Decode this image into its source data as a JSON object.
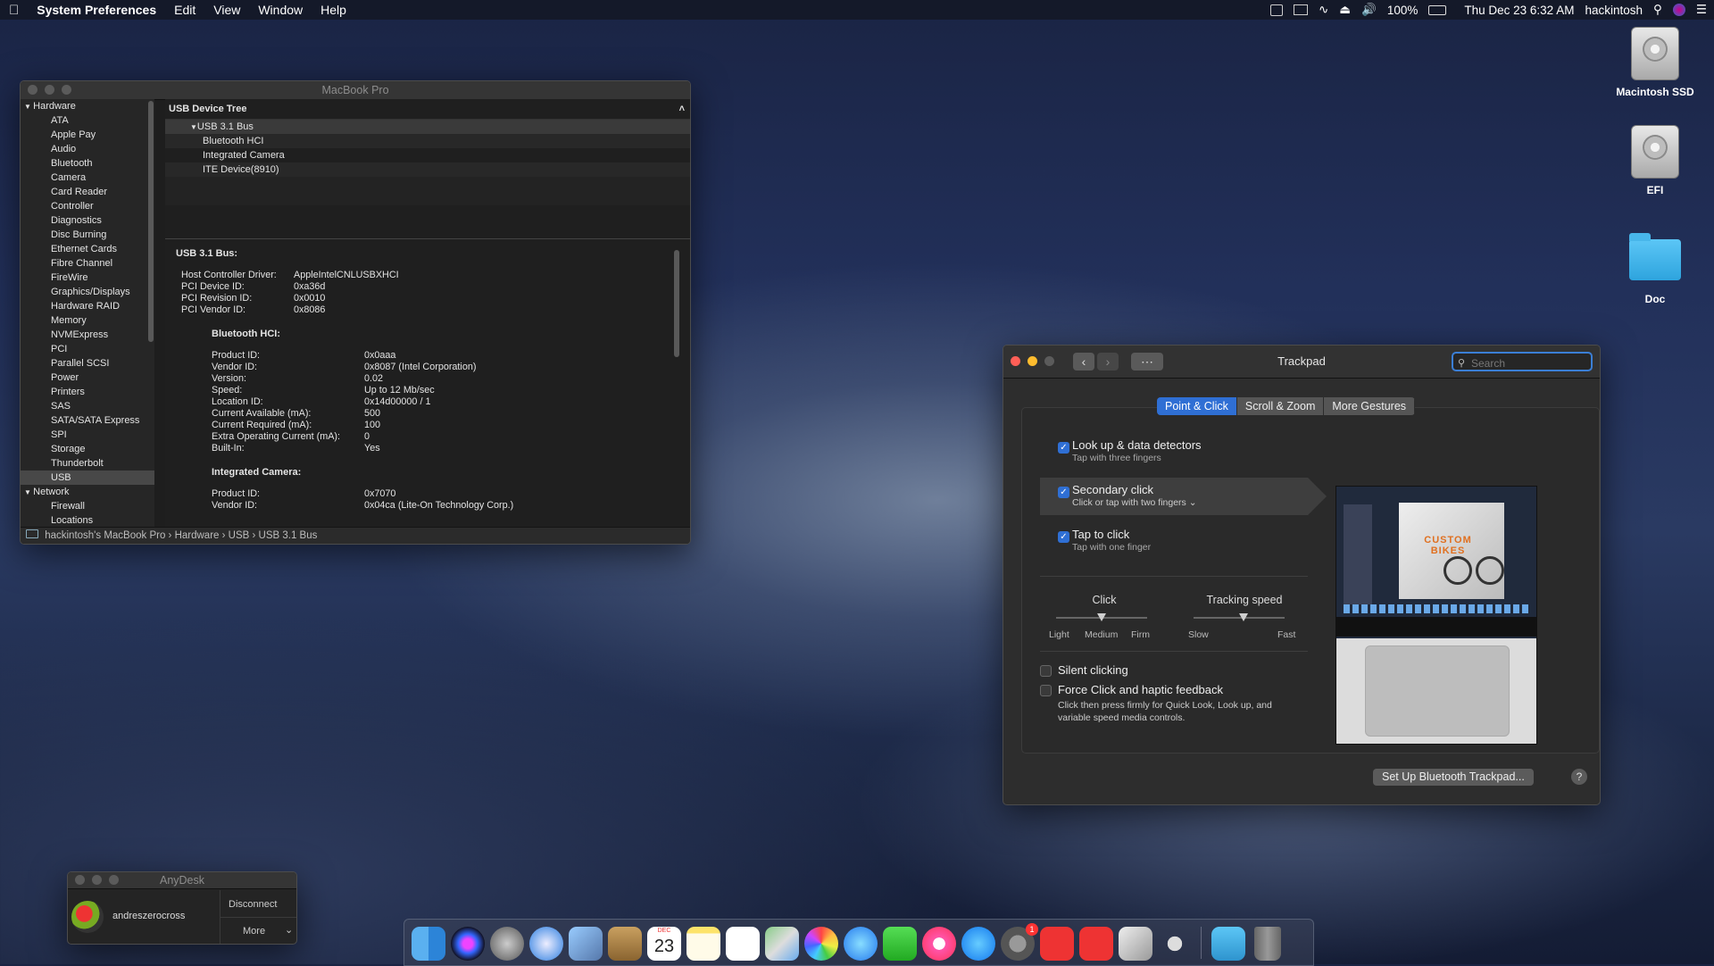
{
  "menubar": {
    "app": "System Preferences",
    "menus": [
      "Edit",
      "View",
      "Window",
      "Help"
    ],
    "battery": "100%",
    "datetime": "Thu Dec 23  6:32 AM",
    "user": "hackintosh"
  },
  "desktop_icons": [
    "Macintosh SSD",
    "EFI",
    "Doc"
  ],
  "sysinfo": {
    "title": "MacBook Pro",
    "sidebar": [
      {
        "label": "Hardware",
        "group": true
      },
      {
        "label": "ATA"
      },
      {
        "label": "Apple Pay"
      },
      {
        "label": "Audio"
      },
      {
        "label": "Bluetooth"
      },
      {
        "label": "Camera"
      },
      {
        "label": "Card Reader"
      },
      {
        "label": "Controller"
      },
      {
        "label": "Diagnostics"
      },
      {
        "label": "Disc Burning"
      },
      {
        "label": "Ethernet Cards"
      },
      {
        "label": "Fibre Channel"
      },
      {
        "label": "FireWire"
      },
      {
        "label": "Graphics/Displays"
      },
      {
        "label": "Hardware RAID"
      },
      {
        "label": "Memory"
      },
      {
        "label": "NVMExpress"
      },
      {
        "label": "PCI"
      },
      {
        "label": "Parallel SCSI"
      },
      {
        "label": "Power"
      },
      {
        "label": "Printers"
      },
      {
        "label": "SAS"
      },
      {
        "label": "SATA/SATA Express"
      },
      {
        "label": "SPI"
      },
      {
        "label": "Storage"
      },
      {
        "label": "Thunderbolt"
      },
      {
        "label": "USB",
        "selected": true
      },
      {
        "label": "Network",
        "group": true
      },
      {
        "label": "Firewall"
      },
      {
        "label": "Locations"
      }
    ],
    "tree_header": "USB Device Tree",
    "tree": [
      {
        "label": "USB 3.1 Bus",
        "bus": true
      },
      {
        "label": "Bluetooth HCI"
      },
      {
        "label": "Integrated Camera"
      },
      {
        "label": "ITE Device(8910)"
      }
    ],
    "detail_title": "USB 3.1 Bus:",
    "bus_props": [
      [
        "Host Controller Driver:",
        "AppleIntelCNLUSBXHCI"
      ],
      [
        "PCI Device ID:",
        "0xa36d"
      ],
      [
        "PCI Revision ID:",
        "0x0010"
      ],
      [
        "PCI Vendor ID:",
        "0x8086"
      ]
    ],
    "bt_title": "Bluetooth HCI:",
    "bt_props": [
      [
        "Product ID:",
        "0x0aaa"
      ],
      [
        "Vendor ID:",
        "0x8087  (Intel Corporation)"
      ],
      [
        "Version:",
        "0.02"
      ],
      [
        "Speed:",
        "Up to 12 Mb/sec"
      ],
      [
        "Location ID:",
        "0x14d00000 / 1"
      ],
      [
        "Current Available (mA):",
        "500"
      ],
      [
        "Current Required (mA):",
        "100"
      ],
      [
        "Extra Operating Current (mA):",
        "0"
      ],
      [
        "Built-In:",
        "Yes"
      ]
    ],
    "cam_title": "Integrated Camera:",
    "cam_props": [
      [
        "Product ID:",
        "0x7070"
      ],
      [
        "Vendor ID:",
        "0x04ca  (Lite-On Technology Corp.)"
      ]
    ],
    "path": "hackintosh's MacBook Pro  ›  Hardware  ›  USB  ›  USB 3.1 Bus"
  },
  "trackpad": {
    "title": "Trackpad",
    "search_placeholder": "Search",
    "tabs": [
      "Point & Click",
      "Scroll & Zoom",
      "More Gestures"
    ],
    "options": [
      {
        "title": "Look up & data detectors",
        "sub": "Tap with three fingers",
        "checked": true
      },
      {
        "title": "Secondary click",
        "sub": "Click or tap with two fingers ⌄",
        "checked": true
      },
      {
        "title": "Tap to click",
        "sub": "Tap with one finger",
        "checked": true
      }
    ],
    "click": {
      "label": "Click",
      "ticks": [
        "Light",
        "Medium",
        "Firm"
      ],
      "value": "Medium"
    },
    "tracking": {
      "label": "Tracking speed",
      "ticks": [
        "Slow",
        "Fast"
      ],
      "level": 0.55
    },
    "silent": "Silent clicking",
    "force": "Force Click and haptic feedback",
    "force_desc": "Click then press firmly for Quick Look, Look up, and variable speed media controls.",
    "preview_text": "CUSTOM BIKES",
    "setup_button": "Set Up Bluetooth Trackpad...",
    "help": "?"
  },
  "anydesk": {
    "title": "AnyDesk",
    "user": "andreszerocross",
    "disconnect": "Disconnect",
    "more": "More"
  },
  "calendar_day": "23",
  "calendar_month": "DEC",
  "badge": "1"
}
